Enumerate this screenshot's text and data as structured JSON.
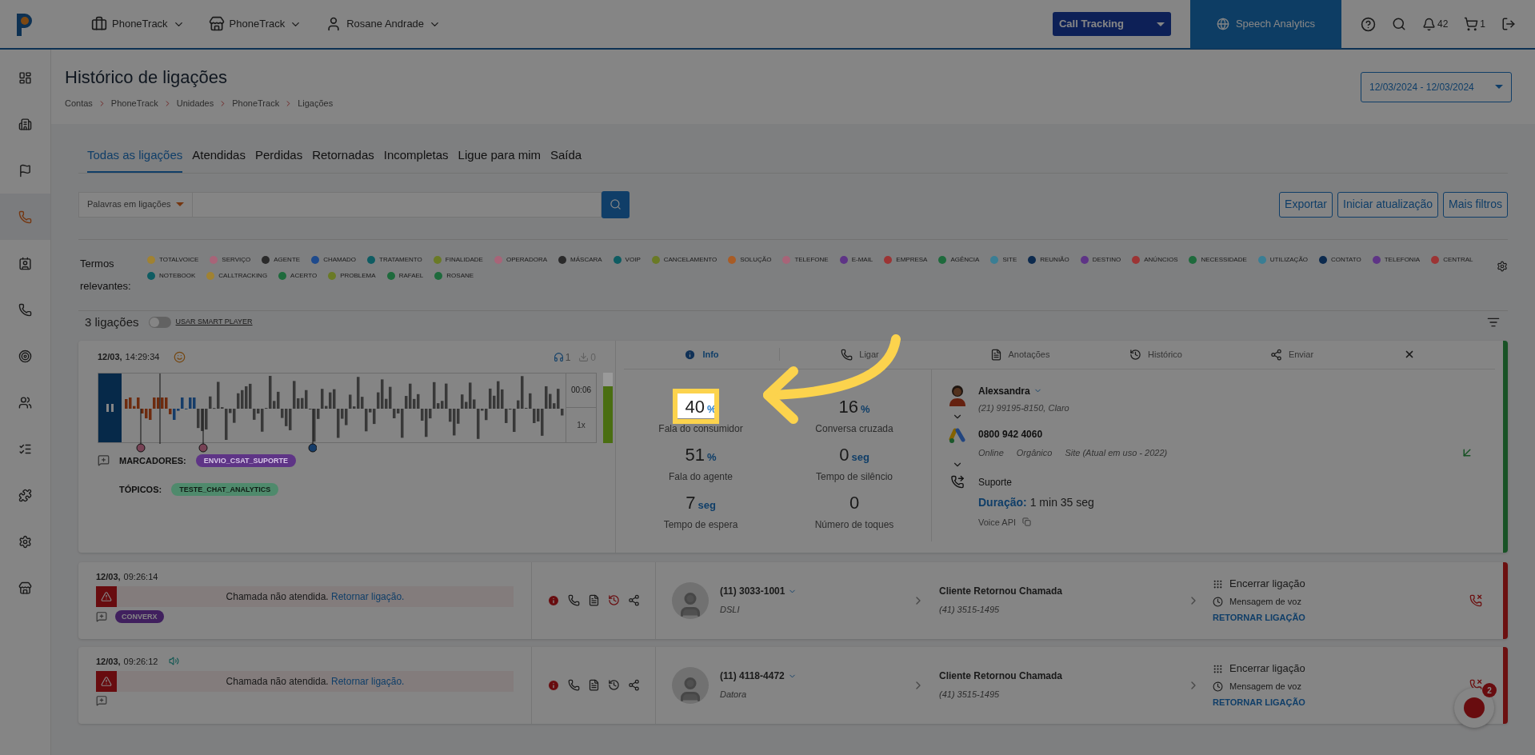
{
  "header": {
    "nav": [
      {
        "label": "PhoneTrack",
        "kind": "briefcase"
      },
      {
        "label": "PhoneTrack",
        "kind": "store"
      },
      {
        "label": "Rosane Andrade",
        "kind": "user"
      }
    ],
    "product_select": "Call Tracking",
    "speech_analytics": "Speech Analytics",
    "notifications": "42",
    "cart": "1"
  },
  "sidebar": {
    "items": [
      {
        "kind": "dashboard",
        "selected": false
      },
      {
        "kind": "building",
        "selected": false
      },
      {
        "kind": "flag",
        "selected": false
      },
      {
        "kind": "phone",
        "selected": true
      },
      {
        "kind": "contact",
        "selected": false
      },
      {
        "kind": "phone",
        "selected": false
      },
      {
        "kind": "target",
        "selected": false
      },
      {
        "kind": "users",
        "selected": false
      },
      {
        "kind": "list",
        "selected": false
      },
      {
        "kind": "puzzle",
        "selected": false
      },
      {
        "kind": "settings",
        "selected": false
      },
      {
        "kind": "store",
        "selected": false
      }
    ]
  },
  "page": {
    "title": "Histórico de ligações",
    "breadcrumb": [
      "Contas",
      "PhoneTrack",
      "Unidades",
      "PhoneTrack",
      "Ligações"
    ],
    "date_range": "12/03/2024 - 12/03/2024"
  },
  "tabs": [
    {
      "label": "Todas as ligações",
      "selected": true
    },
    {
      "label": "Atendidas",
      "selected": false
    },
    {
      "label": "Perdidas",
      "selected": false
    },
    {
      "label": "Retornadas",
      "selected": false
    },
    {
      "label": "Incompletas",
      "selected": false
    },
    {
      "label": "Ligue para mim",
      "selected": false
    },
    {
      "label": "Saída",
      "selected": false
    }
  ],
  "search": {
    "filter": "Palavras em ligações"
  },
  "buttons": [
    "Exportar",
    "Iniciar atualização",
    "Mais filtros"
  ],
  "terms": {
    "label": "Termos relevantes:",
    "items": [
      {
        "label": "TOTALVOICE",
        "color": "#a08232"
      },
      {
        "label": "SERVIÇO",
        "color": "#a86478"
      },
      {
        "label": "AGENTE",
        "color": "#2a2a2a"
      },
      {
        "label": "CHAMADO",
        "color": "#1e4a8c"
      },
      {
        "label": "TRATAMENTO",
        "color": "#0e5c62"
      },
      {
        "label": "FINALIDADE",
        "color": "#6a7a26"
      },
      {
        "label": "OPERADORA",
        "color": "#a86478"
      },
      {
        "label": "MÁSCARA",
        "color": "#2a2a2a"
      },
      {
        "label": "VOIP",
        "color": "#0e5c62"
      },
      {
        "label": "CANCELAMENTO",
        "color": "#6a7a26"
      },
      {
        "label": "SOLUÇÃO",
        "color": "#a85c26"
      },
      {
        "label": "TELEFONE",
        "color": "#a86478"
      },
      {
        "label": "E-MAIL",
        "color": "#5e3486"
      },
      {
        "label": "EMPRESA",
        "color": "#9c3434"
      },
      {
        "label": "AGÊNCIA",
        "color": "#1e6a3c"
      },
      {
        "label": "SITE",
        "color": "#3a7e94"
      },
      {
        "label": "REUNIÃO",
        "color": "#0c2a4e"
      },
      {
        "label": "DESTINO",
        "color": "#5e3486"
      },
      {
        "label": "ANÚNCIOS",
        "color": "#9c3434"
      },
      {
        "label": "NECESSIDADE",
        "color": "#1e6a3c"
      },
      {
        "label": "UTILIZAÇÃO",
        "color": "#3a7e94"
      },
      {
        "label": "CONTATO",
        "color": "#0c2a4e"
      },
      {
        "label": "TELEFONIA",
        "color": "#5e3486"
      },
      {
        "label": "CENTRAL",
        "color": "#9c3434"
      },
      {
        "label": "NOTEBOOK",
        "color": "#0e5c62"
      },
      {
        "label": "CALLTRACKING",
        "color": "#a08232"
      },
      {
        "label": "ACERTO",
        "color": "#1e6a3c"
      },
      {
        "label": "PROBLEMA",
        "color": "#6a7a26"
      },
      {
        "label": "RAFAEL",
        "color": "#1e6a3c"
      },
      {
        "label": "ROSANE",
        "color": "#1e6a3c"
      }
    ]
  },
  "list": {
    "count": "3 ligações",
    "smart_player": {
      "label": "USAR SMART PLAYER",
      "on": false
    }
  },
  "call": {
    "date": "12/03,",
    "time": "14:29:34",
    "listens": "1",
    "downloads": "0",
    "player_time": "00:06",
    "speed": "1x",
    "level": 0.8,
    "markers_label": "MARCADORES:",
    "marker": {
      "label": "ENVIO_CSAT_SUPORTE",
      "color": "#5e3486"
    },
    "topics_label": "TÓPICOS:",
    "topic": {
      "label": "TESTE_CHAT_ANALYTICS",
      "color": "#4f8a6c"
    },
    "detail_tabs": [
      {
        "label": "Info",
        "kind": "info",
        "selected": true
      },
      {
        "label": "Ligar",
        "kind": "phone",
        "selected": false
      },
      {
        "label": "Anotações",
        "kind": "notes",
        "selected": false
      },
      {
        "label": "Histórico",
        "kind": "history",
        "selected": false
      },
      {
        "label": "Enviar",
        "kind": "share",
        "selected": false
      }
    ],
    "stats": [
      {
        "value": "40",
        "unit": "%",
        "label": "Fala do consumidor",
        "highlighted": true
      },
      {
        "value": "16",
        "unit": "%",
        "label": "Conversa cruzada",
        "highlighted": false
      },
      {
        "value": "51",
        "unit": "%",
        "label": "Fala do agente",
        "highlighted": false
      },
      {
        "value": "0",
        "unit": "seg",
        "label": "Tempo de silêncio",
        "highlighted": false
      },
      {
        "value": "7",
        "unit": "seg",
        "label": "Tempo de espera",
        "highlighted": false
      },
      {
        "value": "0",
        "label": "Número de toques",
        "highlighted": false
      }
    ],
    "caller": {
      "name": "Alexsandra",
      "phone": "(21) 99195-8150, Claro"
    },
    "source": {
      "number": "0800 942 4060",
      "tags": [
        "Online",
        "Orgânico",
        "Site (Atual em uso - 2022)"
      ]
    },
    "department": "Suporte",
    "duration_label": "Duração:",
    "duration": "1 min 35 seg",
    "integration": "Voice API"
  },
  "missed_calls": [
    {
      "date": "12/03,",
      "time": "09:26:14",
      "voice_icon": false,
      "alert": "Chamada não atendida.",
      "link": "Retornar ligação.",
      "tag": "CONVERX",
      "history_alert": true,
      "number": "(11) 3033-1001",
      "carrier": "DSLI",
      "destination": "Cliente Retornou Chamada",
      "destination_phone": "(41) 3515-1495",
      "end": "Encerrar ligação",
      "voicemail": "Mensagem de voz",
      "action": "RETORNAR LIGAÇÃO"
    },
    {
      "date": "12/03,",
      "time": "09:26:12",
      "voice_icon": true,
      "alert": "Chamada não atendida.",
      "link": "Retornar ligação.",
      "history_alert": false,
      "number": "(11) 4118-4472",
      "carrier": "Datora",
      "destination": "Cliente Retornou Chamada",
      "destination_phone": "(41) 3515-1495",
      "end": "Encerrar ligação",
      "voicemail": "Mensagem de voz",
      "action": "RETORNAR LIGAÇÃO"
    }
  ],
  "chat_widget": {
    "badge": "2"
  }
}
